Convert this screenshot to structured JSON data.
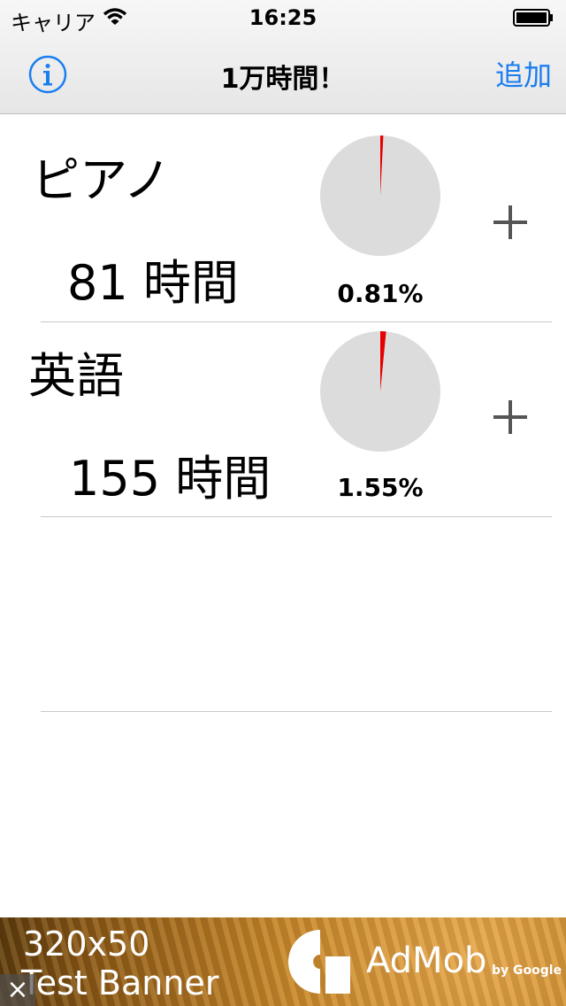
{
  "status": {
    "carrier": "キャリア",
    "time": "16:25"
  },
  "nav": {
    "title": "1万時間！",
    "add_label": "追加"
  },
  "tasks": [
    {
      "name": "ピアノ",
      "hours": "81 時間",
      "percent_label": "0.81%",
      "fraction": 0.0081
    },
    {
      "name": "英語",
      "hours": "155 時間",
      "percent_label": "1.55%",
      "fraction": 0.0155
    }
  ],
  "ad": {
    "size": "320x50",
    "text": "Test Banner",
    "brand": "AdMob",
    "by": "by Google",
    "close": "×"
  },
  "colors": {
    "accent": "#1a7df0",
    "pie_bg": "#dcdcdc",
    "pie_fill": "#e60000"
  }
}
